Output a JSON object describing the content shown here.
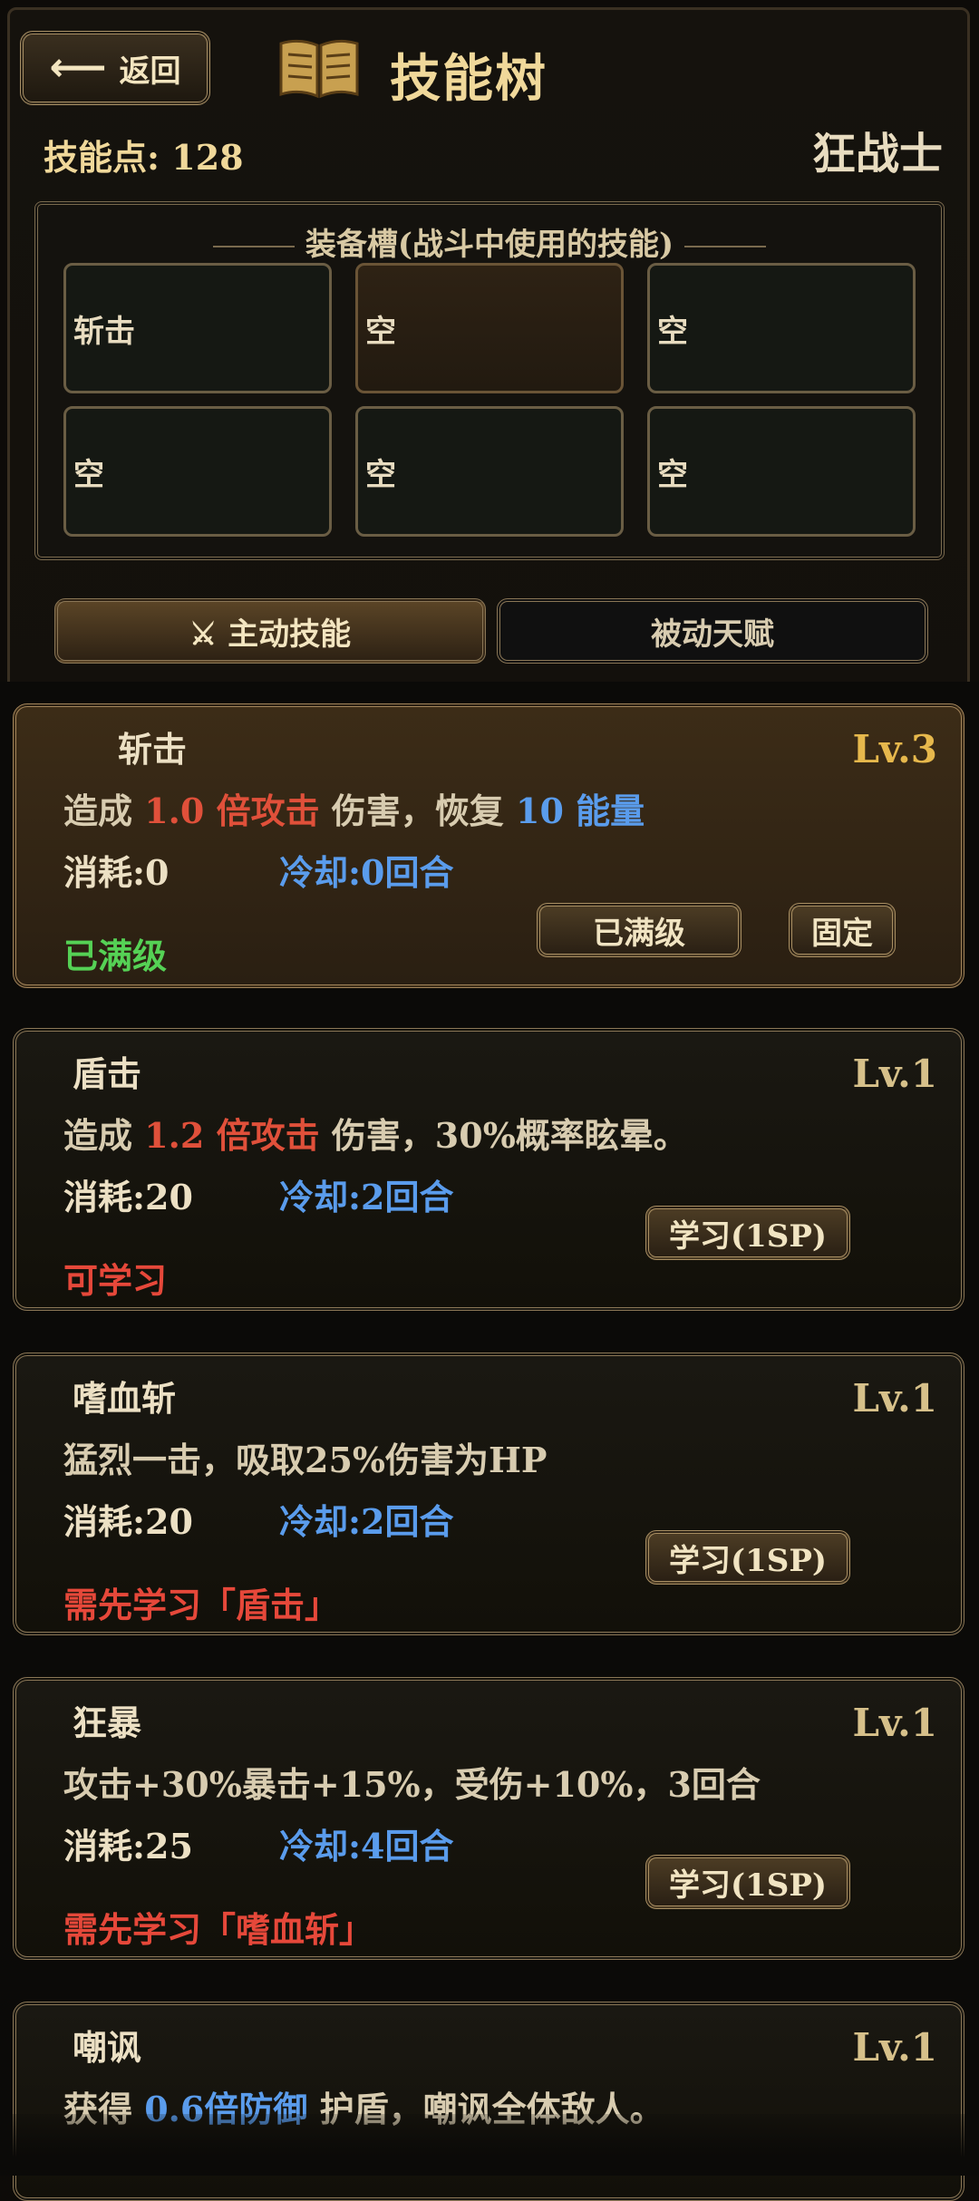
{
  "header": {
    "back_label": "返回",
    "title": "技能树",
    "skill_points": "技能点: 128",
    "class_name": "狂战士"
  },
  "equip": {
    "title": "装备槽(战斗中使用的技能)",
    "slots": [
      "斩击",
      "空",
      "空",
      "空",
      "空",
      "空"
    ]
  },
  "tabs": {
    "active": "⚔ 主动技能",
    "passive": "被动天赋"
  },
  "skills": [
    {
      "name": "斩击",
      "level": "Lv.3",
      "desc": {
        "a": "造成 ",
        "b": "1.0 倍攻击",
        "c": " 伤害，恢复 ",
        "d": "10 能量"
      },
      "cost": "消耗:0",
      "cooldown": "冷却:0回合",
      "status": "已满级",
      "button": "已满级",
      "pin": "固定"
    },
    {
      "name": "盾击",
      "level": "Lv.1",
      "desc": {
        "a": "造成 ",
        "b": "1.2 倍攻击",
        "c": " 伤害，30%概率眩晕。"
      },
      "cost": "消耗:20",
      "cooldown": "冷却:2回合",
      "status": "可学习",
      "button": "学习(1SP)"
    },
    {
      "name": "嗜血斩",
      "level": "Lv.1",
      "desc": "猛烈一击，吸取25%伤害为HP",
      "cost": "消耗:20",
      "cooldown": "冷却:2回合",
      "status": "需先学习「盾击」",
      "button": "学习(1SP)"
    },
    {
      "name": "狂暴",
      "level": "Lv.1",
      "desc": "攻击+30%暴击+15%，受伤+10%，3回合",
      "cost": "消耗:25",
      "cooldown": "冷却:4回合",
      "status": "需先学习「嗜血斩」",
      "button": "学习(1SP)"
    },
    {
      "name": "嘲讽",
      "level": "Lv.1",
      "desc": {
        "a": "获得 ",
        "b": "0.6倍防御",
        "c": " 护盾，嘲讽全体敌人。"
      }
    }
  ]
}
